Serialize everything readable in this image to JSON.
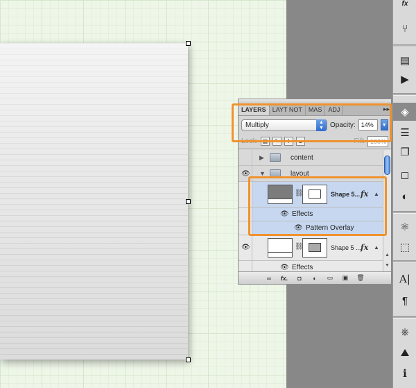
{
  "panel": {
    "tabs": [
      {
        "label": "LAYERS",
        "active": true
      },
      {
        "label": "LAYT NOT",
        "active": false
      },
      {
        "label": "MAS",
        "active": false
      },
      {
        "label": "ADJ",
        "active": false
      }
    ],
    "tab_menu": "▸▸",
    "blend_mode": "Multiply",
    "opacity_label": "Opacity:",
    "opacity_value": "14%",
    "lock_label": "Lock:",
    "fill_label": "Fill:",
    "fill_value": "100%"
  },
  "layers": {
    "content": "content",
    "layout": "layout",
    "shape1": "Shape 5...",
    "effects1": "Effects",
    "pattern_overlay": "Pattern Overlay",
    "shape2": "Shape 5 ...",
    "effects2": "Effects",
    "fx_label": "fx"
  },
  "bottom_bar": {
    "link": "∞",
    "fx": "fx.",
    "mask": "◘",
    "adjust": "◐",
    "group": "▭",
    "new": "▣",
    "delete": "🗑"
  },
  "colors": {
    "highlight": "#f0922e",
    "selection": "#c6d7ef",
    "accent_blue": "#2f6cd0"
  },
  "dock_icons": [
    "fx-icon",
    "usb-icon",
    "actions-icon",
    "play-icon",
    "layers-icon",
    "list-icon",
    "copy-icon",
    "mask-icon",
    "adjust-icon",
    "styles-icon",
    "transform-icon",
    "character-icon",
    "paragraph-icon",
    "navigator-icon",
    "histogram-icon",
    "info-icon"
  ],
  "dock_glyphs": {
    "fx": "fx",
    "usb": "⑂",
    "actions": "▤",
    "play": "▶",
    "layers": "◈",
    "list": "☰",
    "copy": "❐",
    "mask": "◻",
    "adjust": "◐",
    "styles": "⚛",
    "transform": "⬚",
    "character": "A|",
    "paragraph": "¶",
    "navigator": "⎈",
    "histogram": "⛰",
    "info": "ℹ"
  }
}
